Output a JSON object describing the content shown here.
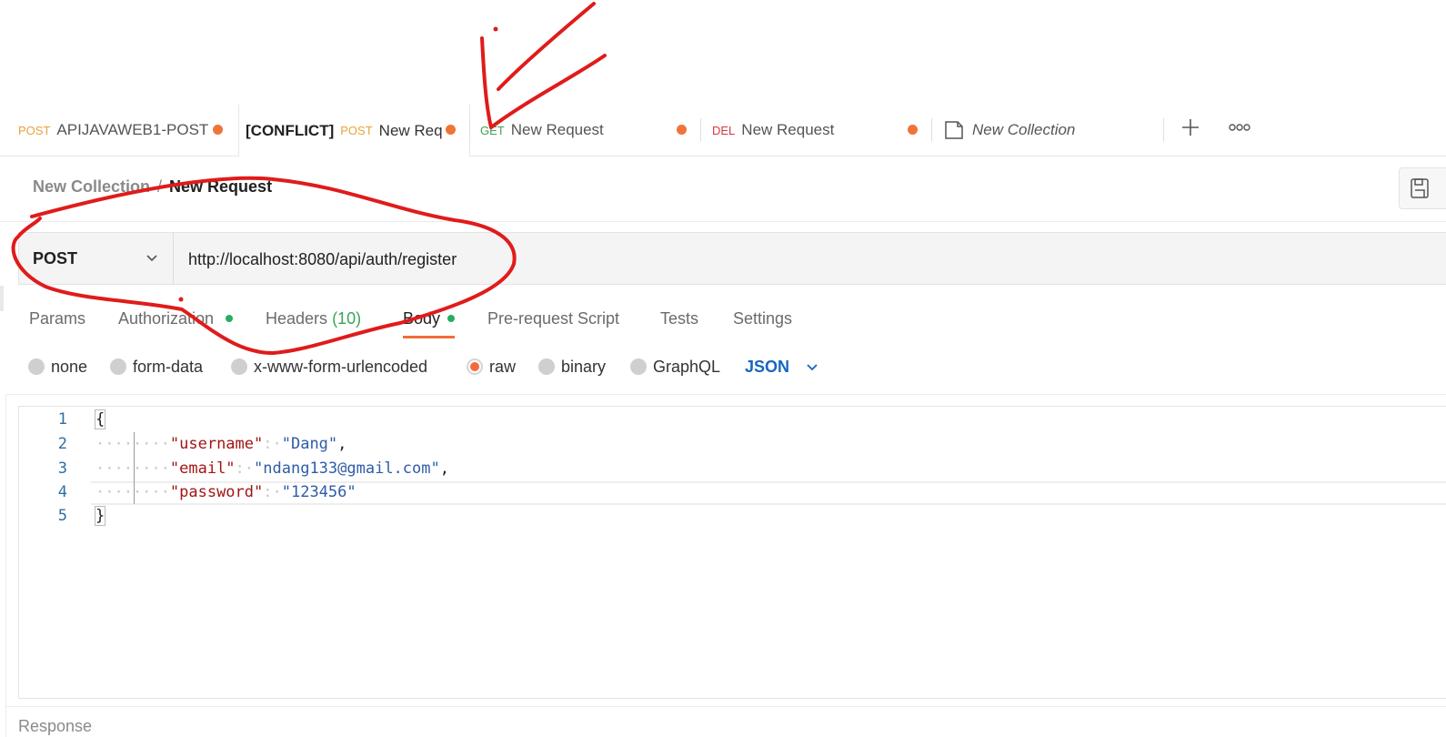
{
  "tabs": [
    {
      "method": "POST",
      "name": "APIJAVAWEB1-POST",
      "prefix": ""
    },
    {
      "method": "POST",
      "name": "New Req",
      "prefix": "[CONFLICT]"
    },
    {
      "method": "GET",
      "name": "New Request",
      "prefix": ""
    },
    {
      "method": "DEL",
      "name": "New Request",
      "prefix": ""
    },
    {
      "name": "New Collection"
    }
  ],
  "tab_actions": {
    "add": "+",
    "more": "ooo"
  },
  "breadcrumb": {
    "collection": "New Collection",
    "separator": "/",
    "request": "New Request"
  },
  "request": {
    "method": "POST",
    "url": "http://localhost:8080/api/auth/register"
  },
  "request_tabs": {
    "params": "Params",
    "authorization": "Authorization",
    "headers": "Headers",
    "headers_count": "(10)",
    "body": "Body",
    "prerequest": "Pre-request Script",
    "tests": "Tests",
    "settings": "Settings"
  },
  "body_types": {
    "none": "none",
    "form_data": "form-data",
    "urlencoded": "x-www-form-urlencoded",
    "raw": "raw",
    "binary": "binary",
    "graphql": "GraphQL",
    "selected": "raw",
    "format": "JSON"
  },
  "editor": {
    "line_numbers": [
      "1",
      "2",
      "3",
      "4",
      "5"
    ],
    "open_brace": "{",
    "close_brace": "}",
    "lines": [
      {
        "key": "\"username\"",
        "value": "\"Dang\"",
        "trail": ","
      },
      {
        "key": "\"email\"",
        "value": "\"ndang133@gmail.com\"",
        "trail": ","
      },
      {
        "key": "\"password\"",
        "value": "\"123456\"",
        "trail": ""
      }
    ],
    "indent": "········",
    "colon": ":·"
  },
  "response_label": "Response",
  "colors": {
    "accent": "#f26b3a",
    "post": "#e8a23b",
    "get": "#3aa45a",
    "del": "#d9363e",
    "json": "#1565c0",
    "annotation": "#e01b1b"
  }
}
